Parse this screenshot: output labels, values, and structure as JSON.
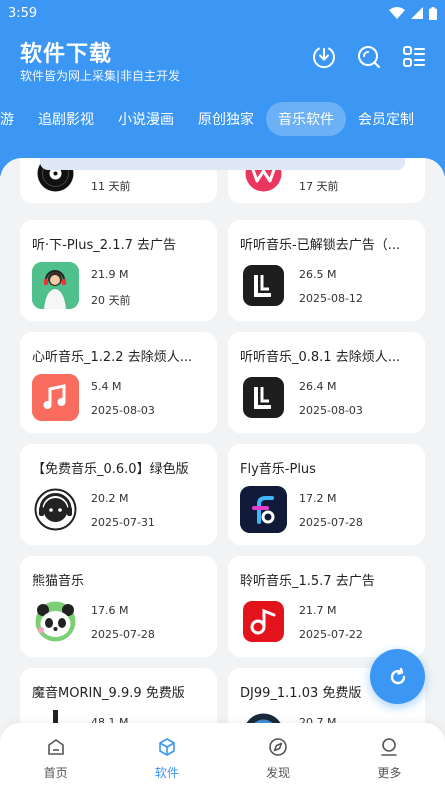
{
  "status": {
    "time": "3:59"
  },
  "header": {
    "title": "软件下载",
    "subtitle": "软件皆为网上采集|非自主开发"
  },
  "tabs": [
    {
      "label": "游"
    },
    {
      "label": "追剧影视"
    },
    {
      "label": "小说漫画"
    },
    {
      "label": "原创独家"
    },
    {
      "label": "音乐软件",
      "active": true
    },
    {
      "label": "会员定制"
    }
  ],
  "apps": [
    {
      "name": "",
      "size": "",
      "date": "11 天前",
      "icon": "vinyl-record-icon"
    },
    {
      "name": "",
      "size": "",
      "date": "17 天前",
      "icon": "pink-w-logo-icon"
    },
    {
      "name": "听·下-Plus_2.1.7 去广告",
      "size": "21.9 M",
      "date": "20 天前",
      "icon": "girl-headphones-icon"
    },
    {
      "name": "听听音乐-已解锁去广告（...",
      "size": "26.5 M",
      "date": "2025-08-12",
      "icon": "black-l-logo-icon"
    },
    {
      "name": "心听音乐_1.2.2 去除烦人...",
      "size": "5.4 M",
      "date": "2025-08-03",
      "icon": "music-note-icon"
    },
    {
      "name": "听听音乐_0.8.1 去除烦人...",
      "size": "26.4 M",
      "date": "2025-08-03",
      "icon": "black-l-logo-icon"
    },
    {
      "name": "【免费音乐_0.6.0】绿色版",
      "size": "20.2 M",
      "date": "2025-07-31",
      "icon": "headphone-face-icon"
    },
    {
      "name": "Fly音乐-Plus",
      "size": "17.2 M",
      "date": "2025-07-28",
      "icon": "fly-f-logo-icon"
    },
    {
      "name": "熊猫音乐",
      "size": "17.6 M",
      "date": "2025-07-28",
      "icon": "panda-icon"
    },
    {
      "name": "聆听音乐_1.5.7 去广告",
      "size": "21.7 M",
      "date": "2025-07-22",
      "icon": "red-note-logo-icon"
    },
    {
      "name": "魔音MORIN_9.9.9 免费版",
      "size": "48.1 M",
      "date": "",
      "icon": "morin-icon"
    },
    {
      "name": "DJ99_1.1.03 免费版",
      "size": "20.7 M",
      "date": "",
      "icon": "dj-disc-icon"
    }
  ],
  "nav": [
    {
      "label": "首页",
      "icon": "home-icon"
    },
    {
      "label": "软件",
      "icon": "cube-icon",
      "active": true
    },
    {
      "label": "发现",
      "icon": "compass-icon"
    },
    {
      "label": "更多",
      "icon": "person-icon"
    }
  ],
  "colors": {
    "primary": "#3b97f3",
    "background": "#f2f3f5"
  }
}
